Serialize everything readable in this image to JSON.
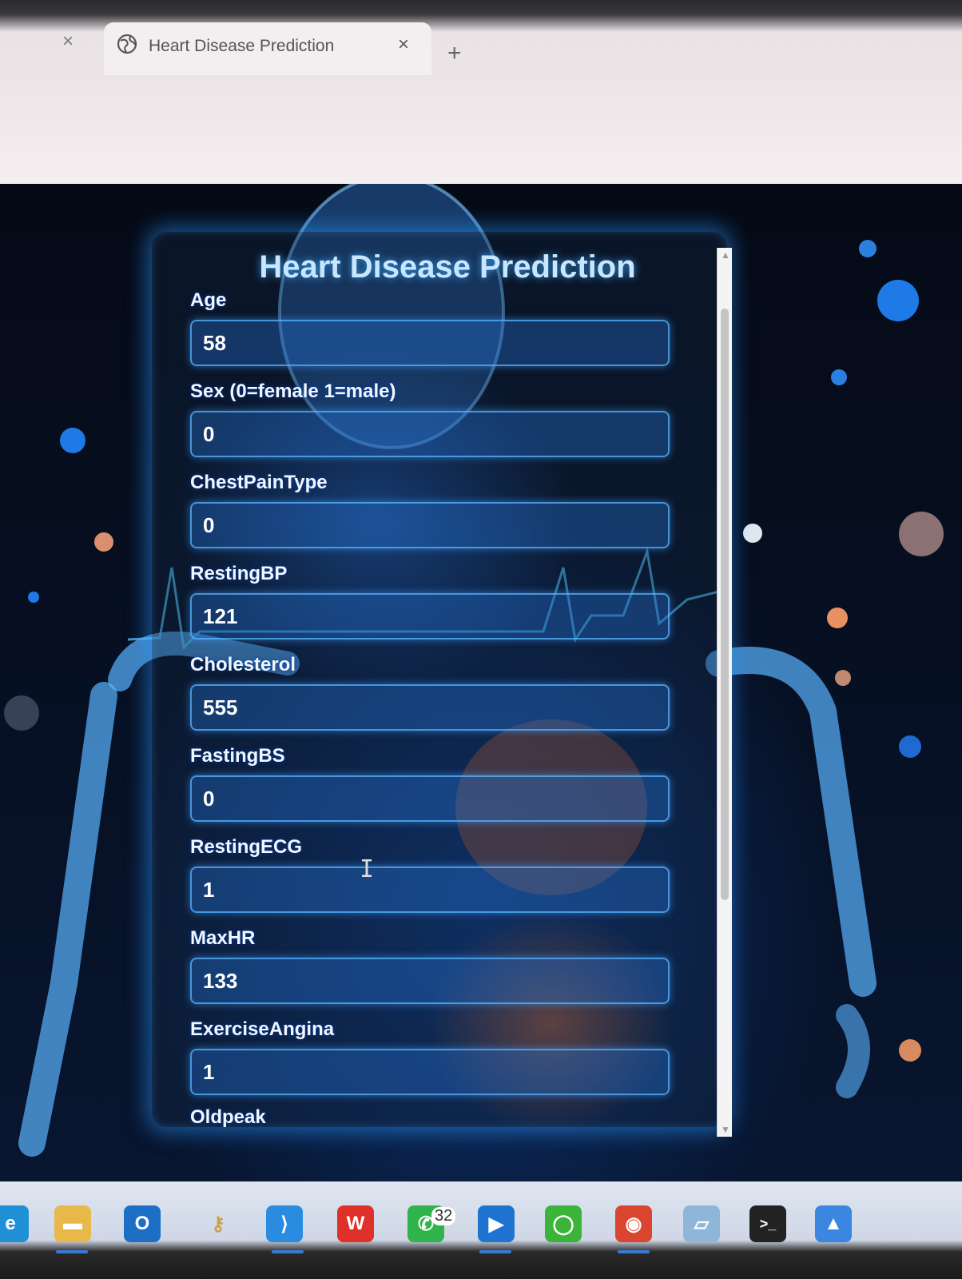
{
  "browser": {
    "tab_title": "Heart Disease Prediction",
    "tab_close": "×",
    "prev_tab_close": "×",
    "new_tab": "+"
  },
  "form": {
    "title": "Heart Disease Prediction",
    "fields": [
      {
        "label": "Age",
        "value": "58"
      },
      {
        "label": "Sex (0=female 1=male)",
        "value": "0"
      },
      {
        "label": "ChestPainType",
        "value": "0"
      },
      {
        "label": "RestingBP",
        "value": "121"
      },
      {
        "label": "Cholesterol",
        "value": "555"
      },
      {
        "label": "FastingBS",
        "value": "0"
      },
      {
        "label": "RestingECG",
        "value": "1"
      },
      {
        "label": "MaxHR",
        "value": "133"
      },
      {
        "label": "ExerciseAngina",
        "value": "1"
      },
      {
        "label": "Oldpeak",
        "value": ""
      }
    ]
  },
  "scrollbar": {
    "up": "▲",
    "down": "▼"
  },
  "cursor": "I",
  "taskbar": {
    "icons": [
      {
        "name": "edge-icon",
        "glyph": "e",
        "color": "#1f8fd6"
      },
      {
        "name": "file-explorer-icon",
        "glyph": "▬",
        "color": "#e8b84a"
      },
      {
        "name": "outlook-icon",
        "glyph": "O",
        "color": "#1c6fc4"
      },
      {
        "name": "key-icon",
        "glyph": "⚷",
        "color": "#c9a24a"
      },
      {
        "name": "vscode-icon",
        "glyph": "⟩",
        "color": "#2a8ce0"
      },
      {
        "name": "wps-office-icon",
        "glyph": "W",
        "color": "#e0302a"
      },
      {
        "name": "whatsapp-icon",
        "glyph": "✆",
        "color": "#2fb34a"
      },
      {
        "name": "media-player-icon",
        "glyph": "▶",
        "color": "#1e74d0"
      },
      {
        "name": "circle-app-icon",
        "glyph": "◯",
        "color": "#3ab53a"
      },
      {
        "name": "chrome-icon",
        "glyph": "◉",
        "color": "#d9452f"
      },
      {
        "name": "notes-app-icon",
        "glyph": "▱",
        "color": "#8fb6d8"
      },
      {
        "name": "terminal-icon",
        "glyph": ">_",
        "color": "#222222"
      },
      {
        "name": "photos-app-icon",
        "glyph": "▲",
        "color": "#3a86e0"
      }
    ],
    "whatsapp_badge": "32"
  }
}
